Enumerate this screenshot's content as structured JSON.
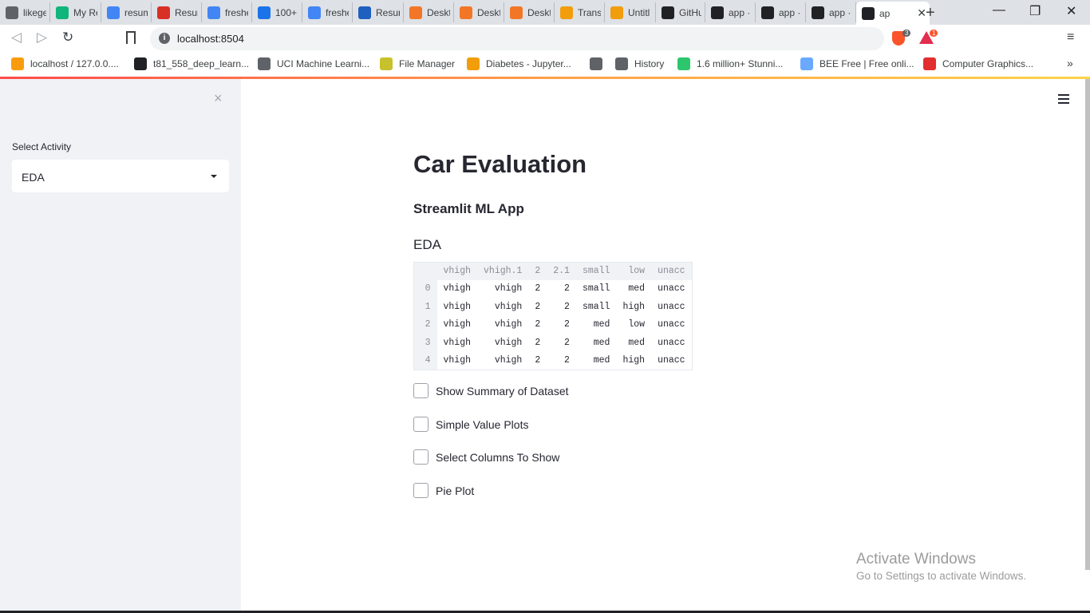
{
  "browser": {
    "tabs": [
      {
        "label": "likege",
        "icon": "globe-icon",
        "color": "#5f6368"
      },
      {
        "label": "My Re",
        "icon": "resume-icon",
        "color": "#0fb57a"
      },
      {
        "label": "resum",
        "icon": "google-icon",
        "color": "#4285f4"
      },
      {
        "label": "Resun",
        "icon": "app-icon",
        "color": "#d93025"
      },
      {
        "label": "freshe",
        "icon": "google-icon",
        "color": "#4285f4"
      },
      {
        "label": "100+",
        "icon": "r-icon",
        "color": "#1a73e8"
      },
      {
        "label": "freshe",
        "icon": "google-icon",
        "color": "#4285f4"
      },
      {
        "label": "Resun",
        "icon": "kaggle-icon",
        "color": "#1f5fbf"
      },
      {
        "label": "Deskt",
        "icon": "jupyter-icon",
        "color": "#f37626"
      },
      {
        "label": "Deskt",
        "icon": "jupyter-icon",
        "color": "#f37626"
      },
      {
        "label": "Deskt",
        "icon": "jupyter-icon",
        "color": "#f37626"
      },
      {
        "label": "Transf",
        "icon": "notebook-icon",
        "color": "#f29d0c"
      },
      {
        "label": "Untitl",
        "icon": "notebook-icon",
        "color": "#f29d0c"
      },
      {
        "label": "GitHu",
        "icon": "github-icon",
        "color": "#202124"
      },
      {
        "label": "app ·",
        "icon": "streamlit-icon",
        "color": "#202124"
      },
      {
        "label": "app ·",
        "icon": "streamlit-icon",
        "color": "#202124"
      },
      {
        "label": "app ·",
        "icon": "streamlit-icon",
        "color": "#202124"
      },
      {
        "label": "ap",
        "icon": "streamlit-icon",
        "color": "#202124",
        "active": true
      }
    ],
    "new_tab": "+",
    "window_controls": {
      "minimize": "—",
      "restore": "❐",
      "close": "✕"
    },
    "url": "localhost:8504",
    "brave_shield_count": "3",
    "rewards_count": "1",
    "bookmarks": [
      {
        "label": "localhost / 127.0.0....",
        "icon": "phpmyadmin-icon",
        "color": "#f89c0e"
      },
      {
        "label": "t81_558_deep_learn...",
        "icon": "github-icon",
        "color": "#202124"
      },
      {
        "label": "UCI Machine Learni...",
        "icon": "globe-icon",
        "color": "#5f6368"
      },
      {
        "label": "File Manager",
        "icon": "file-manager-icon",
        "color": "#c7c12b"
      },
      {
        "label": "Diabetes - Jupyter...",
        "icon": "notebook-icon",
        "color": "#f29d0c"
      },
      {
        "label": "",
        "icon": "globe-icon",
        "color": "#5f6368"
      },
      {
        "label": "History",
        "icon": "history-icon",
        "color": "#5f6368"
      },
      {
        "label": "1.6 million+ Stunni...",
        "icon": "pixabay-icon",
        "color": "#2ec66d"
      },
      {
        "label": "BEE Free | Free onli...",
        "icon": "bee-icon",
        "color": "#6aa9ff"
      },
      {
        "label": "Computer Graphics...",
        "icon": "vivaldi-icon",
        "color": "#e22e2e"
      }
    ],
    "bookmarks_more": "»"
  },
  "sidebar": {
    "close": "×",
    "select_label": "Select Activity",
    "select_value": "EDA"
  },
  "main": {
    "title": "Car Evaluation",
    "subtitle": "Streamlit ML App",
    "section": "EDA",
    "table": {
      "columns": [
        "vhigh",
        "vhigh.1",
        "2",
        "2.1",
        "small",
        "low",
        "unacc"
      ],
      "rows": [
        {
          "index": "0",
          "cells": [
            "vhigh",
            "vhigh",
            "2",
            "2",
            "small",
            "med",
            "unacc"
          ]
        },
        {
          "index": "1",
          "cells": [
            "vhigh",
            "vhigh",
            "2",
            "2",
            "small",
            "high",
            "unacc"
          ]
        },
        {
          "index": "2",
          "cells": [
            "vhigh",
            "vhigh",
            "2",
            "2",
            "med",
            "low",
            "unacc"
          ]
        },
        {
          "index": "3",
          "cells": [
            "vhigh",
            "vhigh",
            "2",
            "2",
            "med",
            "med",
            "unacc"
          ]
        },
        {
          "index": "4",
          "cells": [
            "vhigh",
            "vhigh",
            "2",
            "2",
            "med",
            "high",
            "unacc"
          ]
        }
      ]
    },
    "checkboxes": [
      {
        "label": "Show Summary of Dataset",
        "checked": false
      },
      {
        "label": "Simple Value Plots",
        "checked": false
      },
      {
        "label": "Select Columns To Show",
        "checked": false
      },
      {
        "label": "Pie Plot",
        "checked": false
      }
    ]
  },
  "watermark": {
    "title": "Activate Windows",
    "subtitle": "Go to Settings to activate Windows."
  }
}
